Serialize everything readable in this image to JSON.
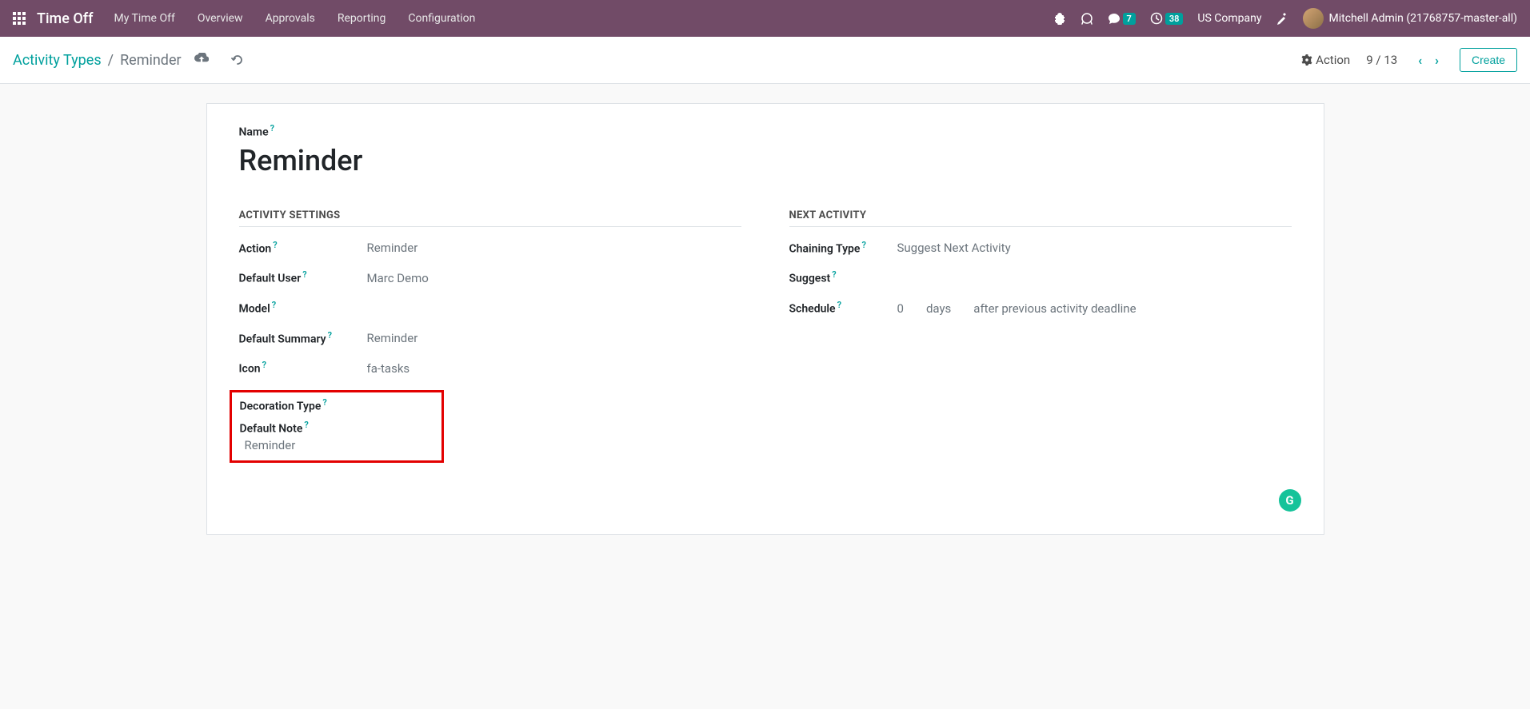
{
  "navbar": {
    "brand": "Time Off",
    "menu": [
      "My Time Off",
      "Overview",
      "Approvals",
      "Reporting",
      "Configuration"
    ],
    "messages_count": "7",
    "activities_count": "38",
    "company": "US Company",
    "user": "Mitchell Admin (21768757-master-all)"
  },
  "breadcrumb": {
    "parent": "Activity Types",
    "current": "Reminder"
  },
  "controls": {
    "action_label": "Action",
    "pager": "9 / 13",
    "create_label": "Create"
  },
  "form": {
    "name_label": "Name",
    "name_value": "Reminder",
    "section_activity": "ACTIVITY SETTINGS",
    "section_next": "NEXT ACTIVITY",
    "fields": {
      "action": {
        "label": "Action",
        "value": "Reminder"
      },
      "default_user": {
        "label": "Default User",
        "value": "Marc Demo"
      },
      "model": {
        "label": "Model",
        "value": ""
      },
      "default_summary": {
        "label": "Default Summary",
        "value": "Reminder"
      },
      "icon": {
        "label": "Icon",
        "value": "fa-tasks"
      },
      "decoration_type": {
        "label": "Decoration Type",
        "value": ""
      },
      "default_note": {
        "label": "Default Note",
        "value": "Reminder"
      },
      "chaining_type": {
        "label": "Chaining Type",
        "value": "Suggest Next Activity"
      },
      "suggest": {
        "label": "Suggest",
        "value": ""
      },
      "schedule": {
        "label": "Schedule",
        "count": "0",
        "unit": "days",
        "delay": "after previous activity deadline"
      }
    }
  }
}
